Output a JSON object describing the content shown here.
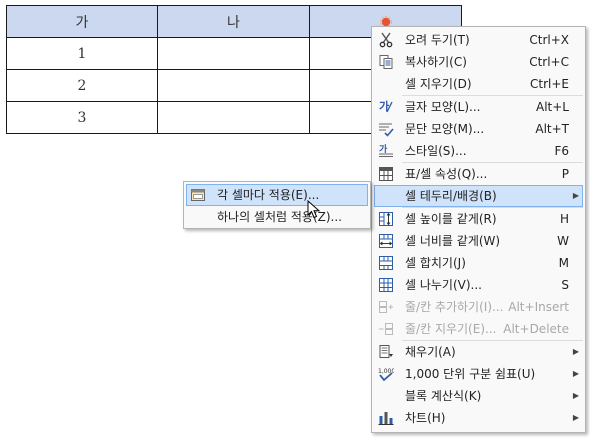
{
  "table": {
    "header": [
      "가",
      "나",
      ""
    ],
    "rows": [
      [
        "1",
        "",
        ""
      ],
      [
        "2",
        "",
        ""
      ],
      [
        "3",
        "",
        ""
      ]
    ]
  },
  "context_menu": {
    "groups": [
      [
        {
          "icon": "scissors-icon",
          "label": "오려 두기(T)",
          "shortcut": "Ctrl+X"
        },
        {
          "icon": "copy-icon",
          "label": "복사하기(C)",
          "shortcut": "Ctrl+C"
        },
        {
          "icon": "",
          "label": "셀 지우기(D)",
          "shortcut": "Ctrl+E"
        }
      ],
      [
        {
          "icon": "font-shape-icon",
          "label": "글자 모양(L)...",
          "shortcut": "Alt+L"
        },
        {
          "icon": "paragraph-shape-icon",
          "label": "문단 모양(M)...",
          "shortcut": "Alt+T"
        },
        {
          "icon": "style-icon",
          "label": "스타일(S)...",
          "shortcut": "F6"
        }
      ],
      [
        {
          "icon": "table-properties-icon",
          "label": "표/셀 속성(Q)...",
          "shortcut": "P"
        },
        {
          "icon": "",
          "label": "셀 테두리/배경(B)",
          "shortcut": "",
          "submenu": true,
          "highlighted": true
        }
      ],
      [
        {
          "icon": "equal-height-icon",
          "label": "셀 높이를 같게(R)",
          "shortcut": "H"
        },
        {
          "icon": "equal-width-icon",
          "label": "셀 너비를 같게(W)",
          "shortcut": "W"
        },
        {
          "icon": "merge-cells-icon",
          "label": "셀 합치기(J)",
          "shortcut": "M"
        },
        {
          "icon": "split-cells-icon",
          "label": "셀 나누기(V)...",
          "shortcut": "S"
        },
        {
          "icon": "insert-row-col-icon",
          "label": "줄/칸 추가하기(I)...",
          "shortcut": "Alt+Insert",
          "disabled": true
        },
        {
          "icon": "delete-row-col-icon",
          "label": "줄/칸 지우기(E)...",
          "shortcut": "Alt+Delete",
          "disabled": true
        }
      ],
      [
        {
          "icon": "fill-icon",
          "label": "채우기(A)",
          "shortcut": "",
          "submenu": true
        },
        {
          "icon": "thousands-separator-icon",
          "label": "1,000 단위 구분 쉼표(U)",
          "shortcut": "",
          "submenu": true
        },
        {
          "icon": "",
          "label": "블록 계산식(K)",
          "shortcut": "",
          "submenu": true
        },
        {
          "icon": "chart-icon",
          "label": "차트(H)",
          "shortcut": "",
          "submenu": true
        }
      ]
    ],
    "submenu_arrow": "▶",
    "thousands_icon_text": "1,000"
  },
  "submenu": {
    "items": [
      {
        "icon": "cell-each-icon",
        "label": "각 셀마다 적용(E)...",
        "highlighted": true
      },
      {
        "icon": "",
        "label": "하나의 셀처럼 적용(Z)...",
        "highlighted": false
      }
    ]
  },
  "colors": {
    "header_bg": "#ccd8f0",
    "highlight_bg": "#cfe3fb",
    "highlight_border": "#7fb2ee",
    "disabled_text": "#a8a8a8",
    "icon_blue": "#2f5ea8",
    "icon_orange": "#e8542f"
  }
}
